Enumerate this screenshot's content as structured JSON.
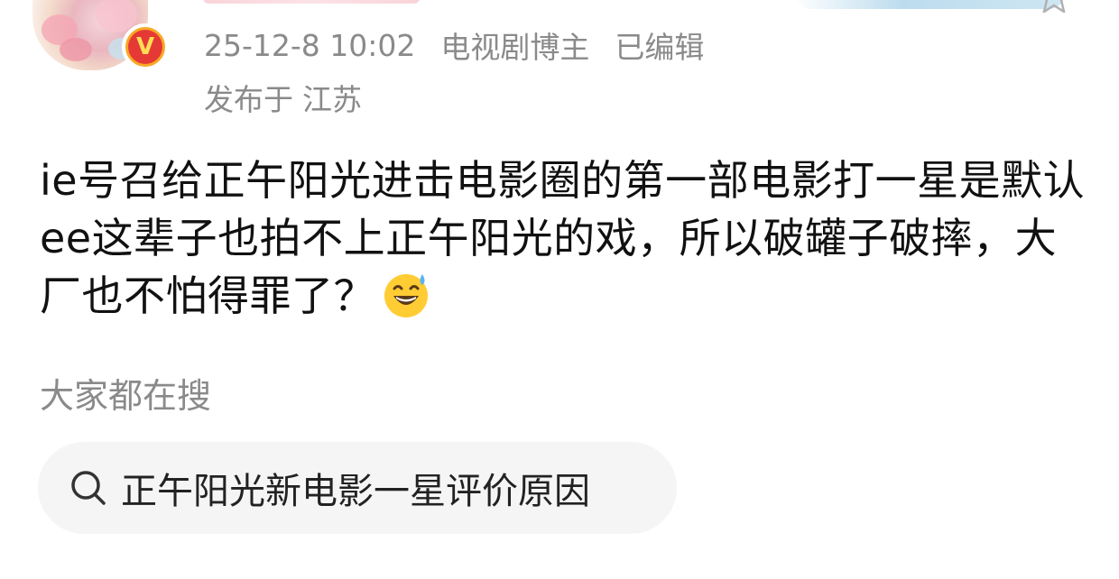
{
  "header": {
    "timestamp": "25-12-8 10:02",
    "user_tag": "电视剧博主",
    "edited_label": "已编辑",
    "location_prefix": "发布于",
    "location": "江苏",
    "badge_letter": "V"
  },
  "post": {
    "text": "ie号召给正午阳光进击电影圈的第一部电影打一星是默认ee这辈子也拍不上正午阳光的戏，所以破罐子破摔，大厂也不怕得罪了？",
    "emoji": "sweat-smile-emoji"
  },
  "trending": {
    "label": "大家都在搜",
    "query": "正午阳光新电影一星评价原因"
  },
  "colors": {
    "meta_gray": "#8a8a8a",
    "text_black": "#111111",
    "chip_bg": "#f5f5f5",
    "badge_orange": "#f9a825",
    "badge_red": "#e53935"
  }
}
